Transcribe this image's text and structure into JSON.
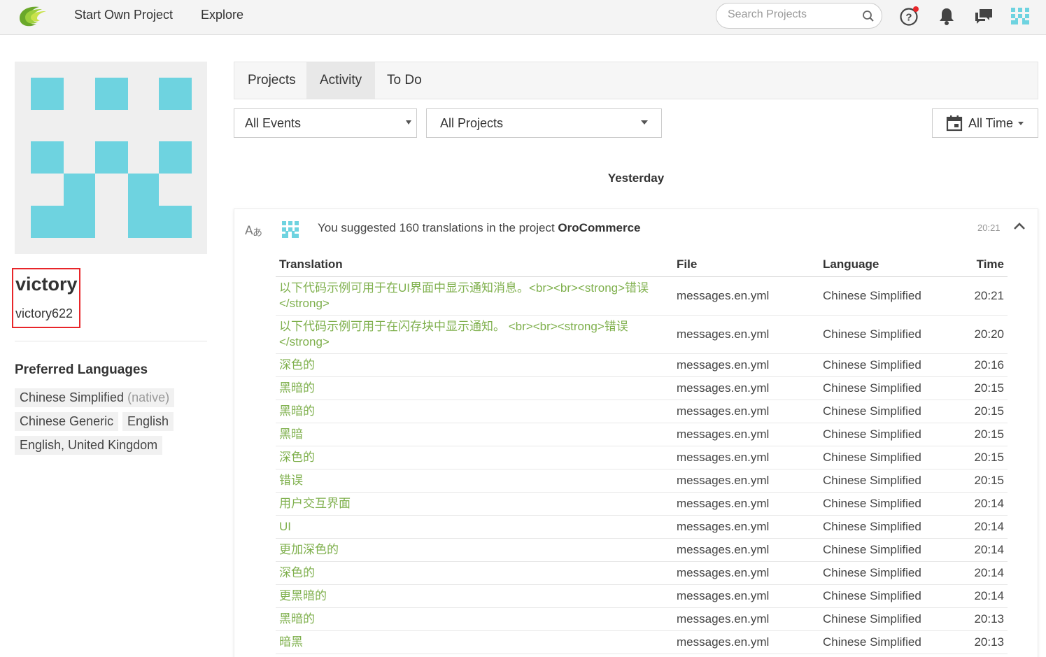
{
  "nav": {
    "start_project": "Start Own Project",
    "explore": "Explore",
    "search_placeholder": "Search Projects"
  },
  "icons": {
    "logo": "crowdin-logo",
    "search": "search-icon",
    "help": "help-icon",
    "notifications": "bell-icon",
    "messages": "chat-icon",
    "avatar": "user-avatar-icon",
    "translate": "translate-icon",
    "collapse": "chevron-up-icon",
    "calendar": "calendar-icon"
  },
  "colors": {
    "accent_green": "#7fb04d",
    "avatar_tile": "#6ed3e0",
    "highlight_border": "#e8262a",
    "notification_dot": "#e8262a"
  },
  "profile": {
    "name": "victory",
    "username": "victory622",
    "preferred_languages_title": "Preferred Languages",
    "languages": [
      {
        "label": "Chinese Simplified",
        "note": "(native)"
      },
      {
        "label": "Chinese Generic",
        "note": ""
      },
      {
        "label": "English",
        "note": ""
      },
      {
        "label": "English, United Kingdom",
        "note": ""
      }
    ]
  },
  "tabs": [
    {
      "label": "Projects",
      "active": false
    },
    {
      "label": "Activity",
      "active": true
    },
    {
      "label": "To Do",
      "active": false
    }
  ],
  "filters": {
    "events": "All Events",
    "projects": "All Projects",
    "time": "All Time"
  },
  "day_label": "Yesterday",
  "activity": {
    "text_prefix": "You suggested 160 translations in the project ",
    "project": "OroCommerce",
    "time": "20:21",
    "headers": {
      "translation": "Translation",
      "file": "File",
      "language": "Language",
      "time": "Time"
    },
    "rows": [
      {
        "translation": "以下代码示例可用于在UI界面中显示通知消息。<br><br><strong>错误</strong>",
        "file": "messages.en.yml",
        "language": "Chinese Simplified",
        "time": "20:21"
      },
      {
        "translation": "以下代码示例可用于在闪存块中显示通知。 <br><br><strong>错误</strong>",
        "file": "messages.en.yml",
        "language": "Chinese Simplified",
        "time": "20:20"
      },
      {
        "translation": "深色的",
        "file": "messages.en.yml",
        "language": "Chinese Simplified",
        "time": "20:16"
      },
      {
        "translation": "黑暗的",
        "file": "messages.en.yml",
        "language": "Chinese Simplified",
        "time": "20:15"
      },
      {
        "translation": "黑暗的",
        "file": "messages.en.yml",
        "language": "Chinese Simplified",
        "time": "20:15"
      },
      {
        "translation": "黑暗",
        "file": "messages.en.yml",
        "language": "Chinese Simplified",
        "time": "20:15"
      },
      {
        "translation": "深色的",
        "file": "messages.en.yml",
        "language": "Chinese Simplified",
        "time": "20:15"
      },
      {
        "translation": "错误",
        "file": "messages.en.yml",
        "language": "Chinese Simplified",
        "time": "20:15"
      },
      {
        "translation": "用户交互界面",
        "file": "messages.en.yml",
        "language": "Chinese Simplified",
        "time": "20:14"
      },
      {
        "translation": "UI",
        "file": "messages.en.yml",
        "language": "Chinese Simplified",
        "time": "20:14"
      },
      {
        "translation": "更加深色的",
        "file": "messages.en.yml",
        "language": "Chinese Simplified",
        "time": "20:14"
      },
      {
        "translation": "深色的",
        "file": "messages.en.yml",
        "language": "Chinese Simplified",
        "time": "20:14"
      },
      {
        "translation": "更黑暗的",
        "file": "messages.en.yml",
        "language": "Chinese Simplified",
        "time": "20:14"
      },
      {
        "translation": "黑暗的",
        "file": "messages.en.yml",
        "language": "Chinese Simplified",
        "time": "20:13"
      },
      {
        "translation": "暗黑",
        "file": "messages.en.yml",
        "language": "Chinese Simplified",
        "time": "20:13"
      }
    ]
  }
}
